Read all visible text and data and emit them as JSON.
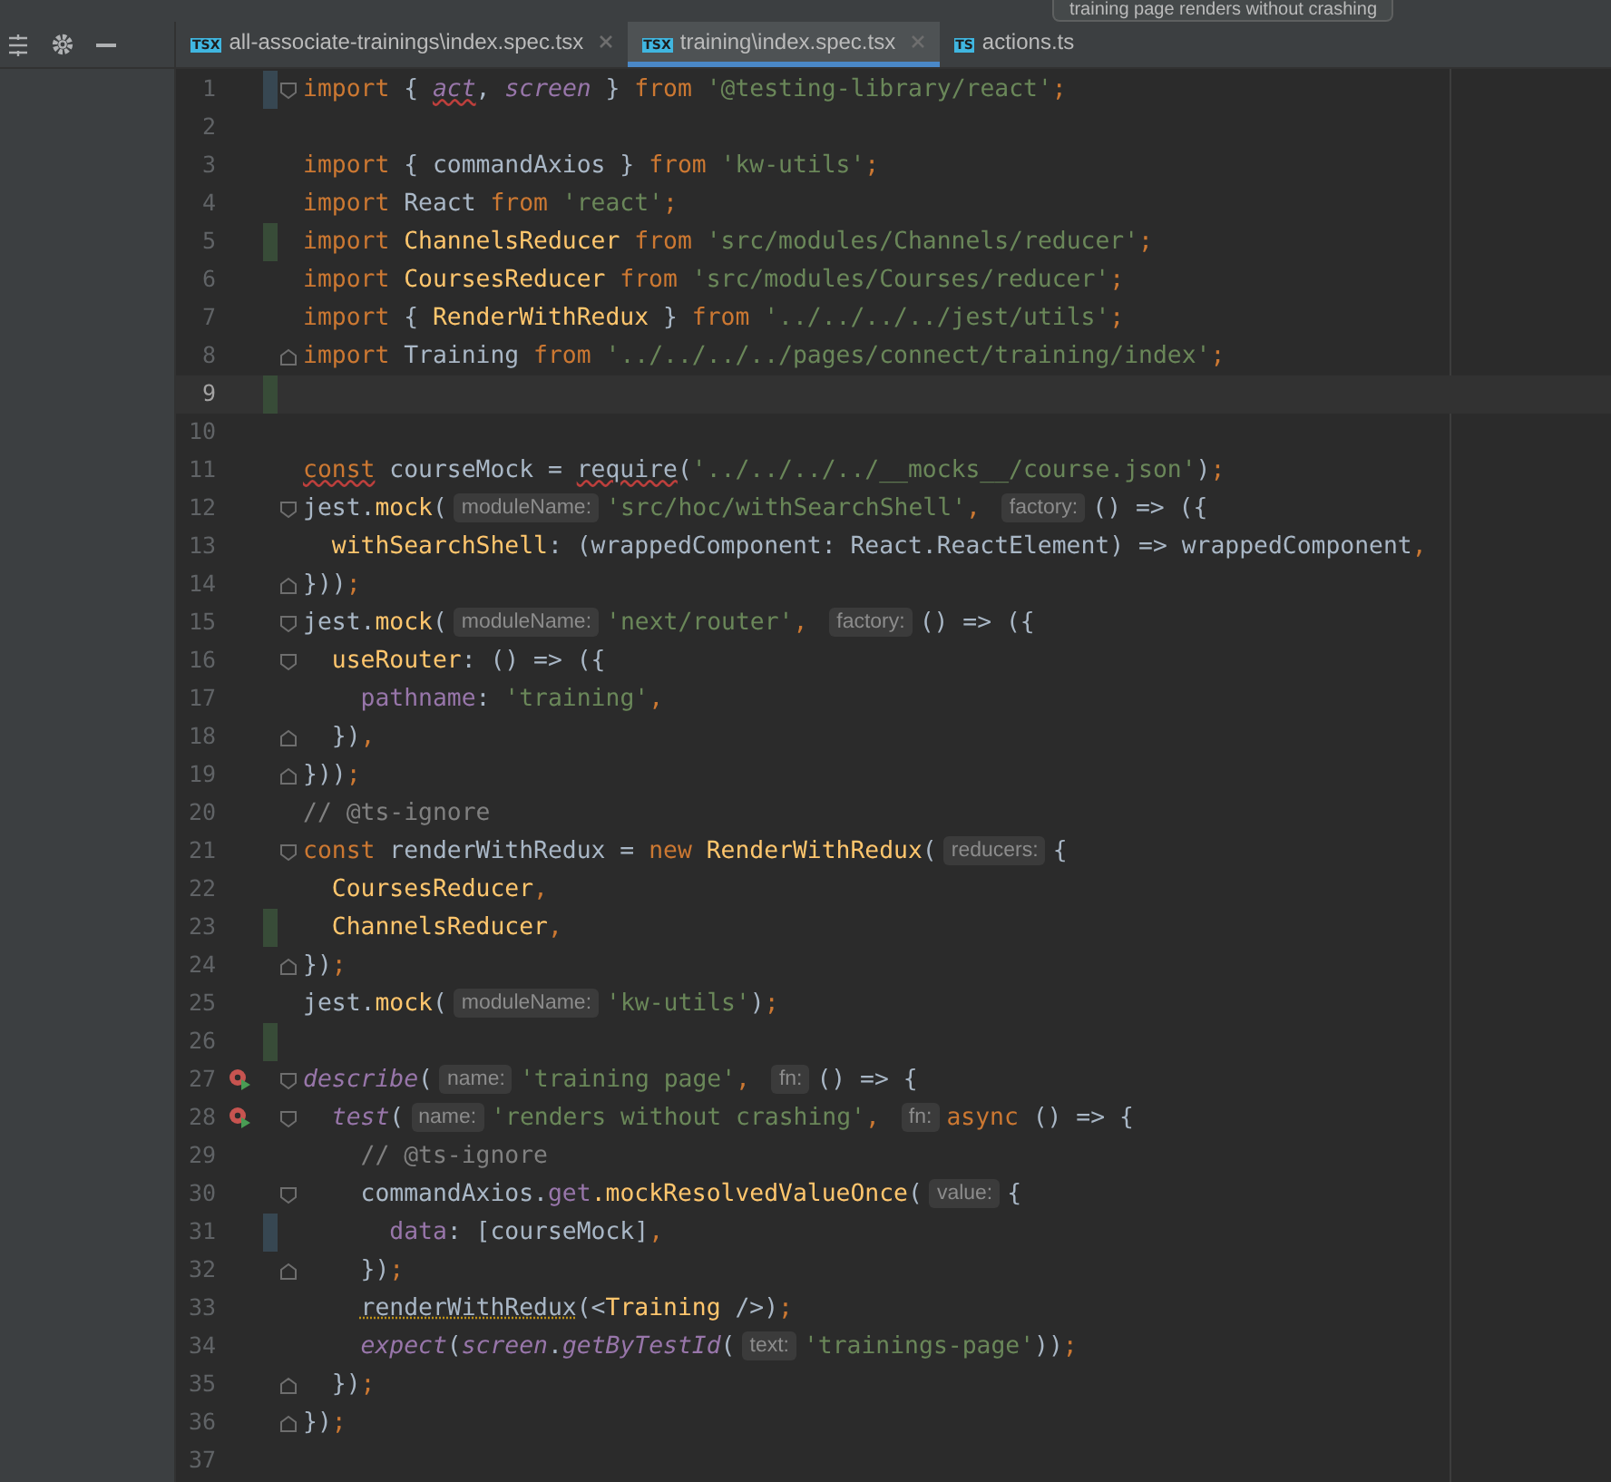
{
  "run_config": {
    "label": "training page renders without crashing"
  },
  "tabs": [
    {
      "badge": "TSX",
      "label": "all-associate-trainings\\index.spec.tsx",
      "selected": false,
      "closable": true
    },
    {
      "badge": "TSX",
      "label": "training\\index.spec.tsx",
      "selected": true,
      "closable": true
    },
    {
      "badge": "TS",
      "label": "actions.ts",
      "selected": false,
      "closable": false
    }
  ],
  "editor": {
    "lines": [
      {
        "number": "1",
        "fold_start": true,
        "modified": true,
        "tokens": [
          {
            "kind": "kw",
            "text": "import "
          },
          {
            "kind": "plain",
            "text": "{ "
          },
          {
            "kind": "italic",
            "text": "act",
            "error_underline": true
          },
          {
            "kind": "plain",
            "text": ", "
          },
          {
            "kind": "italic",
            "text": "screen"
          },
          {
            "kind": "plain",
            "text": " } "
          },
          {
            "kind": "kw",
            "text": "from "
          },
          {
            "kind": "str",
            "text": "'@testing-library/react'"
          },
          {
            "kind": "kw",
            "text": ";"
          }
        ]
      },
      {
        "number": "2"
      },
      {
        "number": "3",
        "tokens": [
          {
            "kind": "kw",
            "text": "import "
          },
          {
            "kind": "plain",
            "text": "{ commandAxios } "
          },
          {
            "kind": "kw",
            "text": "from "
          },
          {
            "kind": "str",
            "text": "'kw-utils'"
          },
          {
            "kind": "kw",
            "text": ";"
          }
        ]
      },
      {
        "number": "4",
        "tokens": [
          {
            "kind": "kw",
            "text": "import "
          },
          {
            "kind": "plain",
            "text": "React "
          },
          {
            "kind": "kw",
            "text": "from "
          },
          {
            "kind": "str",
            "text": "'react'"
          },
          {
            "kind": "kw",
            "text": ";"
          }
        ]
      },
      {
        "number": "5",
        "added": true,
        "tokens": [
          {
            "kind": "kw",
            "text": "import "
          },
          {
            "kind": "fn",
            "text": "ChannelsReducer "
          },
          {
            "kind": "kw",
            "text": "from "
          },
          {
            "kind": "str",
            "text": "'src/modules/Channels/reducer'"
          },
          {
            "kind": "kw",
            "text": ";"
          }
        ]
      },
      {
        "number": "6",
        "tokens": [
          {
            "kind": "kw",
            "text": "import "
          },
          {
            "kind": "fn",
            "text": "CoursesReducer "
          },
          {
            "kind": "kw",
            "text": "from "
          },
          {
            "kind": "str",
            "text": "'src/modules/Courses/reducer'"
          },
          {
            "kind": "kw",
            "text": ";"
          }
        ]
      },
      {
        "number": "7",
        "tokens": [
          {
            "kind": "kw",
            "text": "import "
          },
          {
            "kind": "plain",
            "text": "{ "
          },
          {
            "kind": "fn",
            "text": "RenderWithRedux"
          },
          {
            "kind": "plain",
            "text": " } "
          },
          {
            "kind": "kw",
            "text": "from "
          },
          {
            "kind": "str",
            "text": "'../../../../jest/utils'"
          },
          {
            "kind": "kw",
            "text": ";"
          }
        ]
      },
      {
        "number": "8",
        "fold_end": true,
        "tokens": [
          {
            "kind": "kw",
            "text": "import "
          },
          {
            "kind": "plain",
            "text": "Training "
          },
          {
            "kind": "kw",
            "text": "from "
          },
          {
            "kind": "str",
            "text": "'../../../../pages/connect/training/index'"
          },
          {
            "kind": "kw",
            "text": ";"
          }
        ]
      },
      {
        "number": "9",
        "current": true,
        "added": true
      },
      {
        "number": "10"
      },
      {
        "number": "11",
        "tokens": [
          {
            "kind": "kw",
            "text": "const",
            "error_underline": true
          },
          {
            "kind": "plain",
            "text": " courseMock = "
          },
          {
            "kind": "plain",
            "text": "require",
            "error_underline": true
          },
          {
            "kind": "plain",
            "text": "("
          },
          {
            "kind": "str",
            "text": "'../../../../__mocks__/course.json'"
          },
          {
            "kind": "plain",
            "text": ")"
          },
          {
            "kind": "kw",
            "text": ";"
          }
        ]
      },
      {
        "number": "12",
        "fold_start": true,
        "tokens": [
          {
            "kind": "plain",
            "text": "jest."
          },
          {
            "kind": "fn",
            "text": "mock"
          },
          {
            "kind": "plain",
            "text": "("
          },
          {
            "kind": "hint",
            "text": "moduleName:"
          },
          {
            "kind": "str",
            "text": "'src/hoc/withSearchShell'"
          },
          {
            "kind": "kw",
            "text": ", "
          },
          {
            "kind": "hint",
            "text": "factory:"
          },
          {
            "kind": "plain",
            "text": "() => ({"
          }
        ]
      },
      {
        "number": "13",
        "tokens": [
          {
            "kind": "fn",
            "text": "  withSearchShell"
          },
          {
            "kind": "plain",
            "text": ": (wrappedComponent: React.ReactElement) => wrappedComponent"
          },
          {
            "kind": "kw",
            "text": ","
          }
        ]
      },
      {
        "number": "14",
        "fold_end": true,
        "tokens": [
          {
            "kind": "plain",
            "text": "}))"
          },
          {
            "kind": "kw",
            "text": ";"
          }
        ]
      },
      {
        "number": "15",
        "fold_start": true,
        "tokens": [
          {
            "kind": "plain",
            "text": "jest."
          },
          {
            "kind": "fn",
            "text": "mock"
          },
          {
            "kind": "plain",
            "text": "("
          },
          {
            "kind": "hint",
            "text": "moduleName:"
          },
          {
            "kind": "str",
            "text": "'next/router'"
          },
          {
            "kind": "kw",
            "text": ", "
          },
          {
            "kind": "hint",
            "text": "factory:"
          },
          {
            "kind": "plain",
            "text": "() => ({"
          }
        ]
      },
      {
        "number": "16",
        "fold_start": true,
        "tokens": [
          {
            "kind": "fn",
            "text": "  useRouter"
          },
          {
            "kind": "plain",
            "text": ": () => ({"
          }
        ]
      },
      {
        "number": "17",
        "tokens": [
          {
            "kind": "prop",
            "text": "    pathname"
          },
          {
            "kind": "plain",
            "text": ": "
          },
          {
            "kind": "str",
            "text": "'training'"
          },
          {
            "kind": "kw",
            "text": ","
          }
        ]
      },
      {
        "number": "18",
        "fold_end": true,
        "tokens": [
          {
            "kind": "plain",
            "text": "  })"
          },
          {
            "kind": "kw",
            "text": ","
          }
        ]
      },
      {
        "number": "19",
        "fold_end": true,
        "tokens": [
          {
            "kind": "plain",
            "text": "}))"
          },
          {
            "kind": "kw",
            "text": ";"
          }
        ]
      },
      {
        "number": "20",
        "tokens": [
          {
            "kind": "comment",
            "text": "// @ts-ignore"
          }
        ]
      },
      {
        "number": "21",
        "fold_start": true,
        "tokens": [
          {
            "kind": "kw",
            "text": "const "
          },
          {
            "kind": "plain",
            "text": "renderWithRedux = "
          },
          {
            "kind": "kw",
            "text": "new "
          },
          {
            "kind": "fn",
            "text": "RenderWithRedux"
          },
          {
            "kind": "plain",
            "text": "("
          },
          {
            "kind": "hint",
            "text": "reducers:"
          },
          {
            "kind": "plain",
            "text": "{"
          }
        ]
      },
      {
        "number": "22",
        "tokens": [
          {
            "kind": "fn",
            "text": "  CoursesReducer"
          },
          {
            "kind": "kw",
            "text": ","
          }
        ]
      },
      {
        "number": "23",
        "added": true,
        "tokens": [
          {
            "kind": "fn",
            "text": "  ChannelsReducer"
          },
          {
            "kind": "kw",
            "text": ","
          }
        ]
      },
      {
        "number": "24",
        "fold_end": true,
        "tokens": [
          {
            "kind": "plain",
            "text": "})"
          },
          {
            "kind": "kw",
            "text": ";"
          }
        ]
      },
      {
        "number": "25",
        "tokens": [
          {
            "kind": "plain",
            "text": "jest."
          },
          {
            "kind": "fn",
            "text": "mock"
          },
          {
            "kind": "plain",
            "text": "("
          },
          {
            "kind": "hint",
            "text": "moduleName:"
          },
          {
            "kind": "str",
            "text": "'kw-utils'"
          },
          {
            "kind": "plain",
            "text": ")"
          },
          {
            "kind": "kw",
            "text": ";"
          }
        ]
      },
      {
        "number": "26",
        "added": true
      },
      {
        "number": "27",
        "run": true,
        "fold_start": true,
        "tokens": [
          {
            "kind": "italic",
            "text": "describe"
          },
          {
            "kind": "plain",
            "text": "("
          },
          {
            "kind": "hint",
            "text": "name:"
          },
          {
            "kind": "str",
            "text": "'training page'"
          },
          {
            "kind": "kw",
            "text": ", "
          },
          {
            "kind": "hint",
            "text": "fn:"
          },
          {
            "kind": "plain",
            "text": "() => {"
          }
        ]
      },
      {
        "number": "28",
        "run": true,
        "fold_start": true,
        "tokens": [
          {
            "kind": "italic",
            "text": "  test"
          },
          {
            "kind": "plain",
            "text": "("
          },
          {
            "kind": "hint",
            "text": "name:"
          },
          {
            "kind": "str",
            "text": "'renders without crashing'"
          },
          {
            "kind": "kw",
            "text": ", "
          },
          {
            "kind": "hint",
            "text": "fn:"
          },
          {
            "kind": "kw",
            "text": "async "
          },
          {
            "kind": "plain",
            "text": "() => {"
          }
        ]
      },
      {
        "number": "29",
        "tokens": [
          {
            "kind": "comment",
            "text": "    // @ts-ignore"
          }
        ]
      },
      {
        "number": "30",
        "fold_start": true,
        "tokens": [
          {
            "kind": "plain",
            "text": "    commandAxios."
          },
          {
            "kind": "prop",
            "text": "get"
          },
          {
            "kind": "fn",
            "text": ".mockResolvedValueOnce"
          },
          {
            "kind": "plain",
            "text": "("
          },
          {
            "kind": "hint",
            "text": "value:"
          },
          {
            "kind": "plain",
            "text": "{"
          }
        ]
      },
      {
        "number": "31",
        "modified": true,
        "tokens": [
          {
            "kind": "prop",
            "text": "      data"
          },
          {
            "kind": "plain",
            "text": ": [courseMock]"
          },
          {
            "kind": "kw",
            "text": ","
          }
        ]
      },
      {
        "number": "32",
        "fold_end": true,
        "tokens": [
          {
            "kind": "plain",
            "text": "    })"
          },
          {
            "kind": "kw",
            "text": ";"
          }
        ]
      },
      {
        "number": "33",
        "tokens": [
          {
            "kind": "plain",
            "text": "    renderWithRedux",
            "warning_underline": true
          },
          {
            "kind": "plain",
            "text": "(<"
          },
          {
            "kind": "fn",
            "text": "Training"
          },
          {
            "kind": "plain",
            "text": " />)"
          },
          {
            "kind": "kw",
            "text": ";"
          }
        ]
      },
      {
        "number": "34",
        "tokens": [
          {
            "kind": "italic",
            "text": "    expect"
          },
          {
            "kind": "plain",
            "text": "("
          },
          {
            "kind": "italic",
            "text": "screen"
          },
          {
            "kind": "plain",
            "text": "."
          },
          {
            "kind": "italic",
            "text": "getByTestId"
          },
          {
            "kind": "plain",
            "text": "("
          },
          {
            "kind": "hint",
            "text": "text:"
          },
          {
            "kind": "str",
            "text": "'trainings-page'"
          },
          {
            "kind": "plain",
            "text": "))"
          },
          {
            "kind": "kw",
            "text": ";"
          }
        ]
      },
      {
        "number": "35",
        "fold_end": true,
        "tokens": [
          {
            "kind": "plain",
            "text": "  })"
          },
          {
            "kind": "kw",
            "text": ";"
          }
        ]
      },
      {
        "number": "36",
        "fold_end": true,
        "tokens": [
          {
            "kind": "plain",
            "text": "})"
          },
          {
            "kind": "kw",
            "text": ";"
          }
        ]
      },
      {
        "number": "37"
      }
    ]
  }
}
